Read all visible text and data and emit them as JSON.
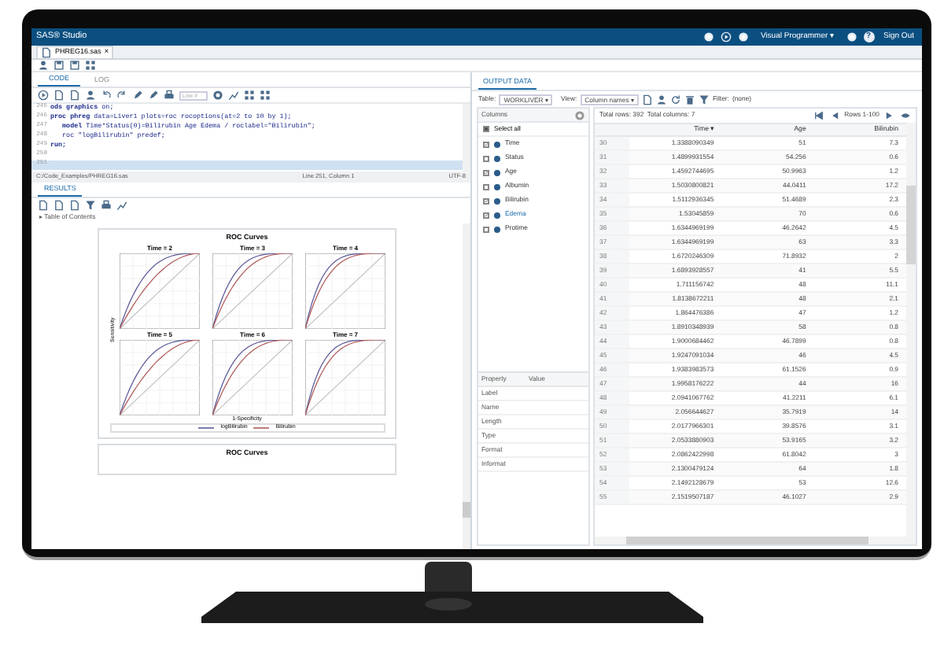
{
  "app_bar": {
    "title": "SAS® Studio",
    "mode": "Visual Programmer ▾",
    "help": "?",
    "sign_out": "Sign Out"
  },
  "file_tabs": [
    {
      "label": "PHREG16.sas",
      "close": "×",
      "selected": true
    }
  ],
  "code_panel": {
    "tabs": [
      {
        "label": "CODE",
        "selected": true
      },
      {
        "label": "LOG",
        "selected": false
      }
    ],
    "line_field": {
      "placeholder": "Line #"
    },
    "lines": [
      {
        "number": "245",
        "code": "**ods graphics** on;",
        "current": false
      },
      {
        "number": "246",
        "code": "**proc phreg** data=Liver1 plots=roc rocoptions(at=2 to 10 by 1);",
        "current": false
      },
      {
        "number": "247",
        "code": "   **model** Time*Status(0)=Bilirubin Age Edema / roclabel=\"Bilirubin\";",
        "current": false
      },
      {
        "number": "248",
        "code": "   roc \"logBilirubin\" predef;",
        "current": false
      },
      {
        "number": "249",
        "code": "**run;**",
        "current": false
      },
      {
        "number": "250",
        "current": false
      },
      {
        "number": "251",
        "current": true
      }
    ],
    "status": {
      "path": "C:/Code_Examples/PHREG16.sas",
      "position": "Line 251, Column 1",
      "encoding": "UTF-8"
    }
  },
  "results_panel": {
    "tabs": [
      {
        "label": "RESULTS",
        "selected": true
      }
    ],
    "toc": "▸ Table of Contents",
    "figures": [
      {
        "title": "ROC Curves",
        "panels": [
          "Time = 2",
          "Time = 3",
          "Time = 4",
          "Time = 5",
          "Time = 6",
          "Time = 7"
        ],
        "ylabel": "Sensitivity",
        "xlabel": "1-Specificity",
        "legend": [
          "logBilirubin",
          "Bilirubin"
        ]
      },
      {
        "title": "ROC Curves"
      }
    ]
  },
  "output_data": {
    "tabs": [
      {
        "label": "OUTPUT DATA",
        "selected": true
      }
    ],
    "table_label": "Table:",
    "table": "WORKLIVER ▾",
    "view_label": "View:",
    "view": "Column names ▾",
    "filter_label": "Filter:",
    "filter": "(none)",
    "columns_panel": {
      "title": "Columns",
      "select_all": {
        "label": "Select all",
        "partial": true
      },
      "items": [
        {
          "label": "Time",
          "checked": true,
          "selected": false
        },
        {
          "label": "Status",
          "checked": false,
          "selected": false
        },
        {
          "label": "Age",
          "checked": true,
          "selected": false
        },
        {
          "label": "Albumin",
          "checked": false,
          "selected": false
        },
        {
          "label": "Bilirubin",
          "checked": true,
          "selected": false
        },
        {
          "label": "Edema",
          "checked": true,
          "selected": true
        },
        {
          "label": "Protime",
          "checked": false,
          "selected": false
        }
      ]
    },
    "properties": {
      "headers": [
        "Property",
        "Value"
      ],
      "rows": [
        "Label",
        "Name",
        "Length",
        "Type",
        "Format",
        "Informat"
      ]
    },
    "grid": {
      "totals": "Total rows: 392  Total columns: 7",
      "range": "Rows 1-100",
      "columns": [
        "",
        "Time ▾",
        "Age",
        "Bilirubin"
      ],
      "rows": [
        [
          "30",
          "1.3388090349",
          "51",
          "7.3"
        ],
        [
          "31",
          "1.4899931554",
          "54.256",
          "0.6"
        ],
        [
          "32",
          "1.4592744695",
          "50.9963",
          "1.2"
        ],
        [
          "33",
          "1.5030800821",
          "44.0411",
          "17.2"
        ],
        [
          "34",
          "1.5112936345",
          "51.4689",
          "2.3"
        ],
        [
          "35",
          "1.53045859",
          "70",
          "0.6"
        ],
        [
          "36",
          "1.6344969199",
          "46.2642",
          "4.5"
        ],
        [
          "37",
          "1.6344969199",
          "63",
          "3.3"
        ],
        [
          "38",
          "1.6720246309",
          "71.8932",
          "2"
        ],
        [
          "39",
          "1.6893928557",
          "41",
          "5.5"
        ],
        [
          "40",
          "1.711156742",
          "48",
          "11.1"
        ],
        [
          "41",
          "1.8138672211",
          "48",
          "2.1"
        ],
        [
          "42",
          "1.864476386",
          "47",
          "1.2"
        ],
        [
          "43",
          "1.8910348939",
          "58",
          "0.8"
        ],
        [
          "44",
          "1.9000684462",
          "46.7899",
          "0.8"
        ],
        [
          "45",
          "1.9247091034",
          "46",
          "4.5"
        ],
        [
          "46",
          "1.9383983573",
          "61.1526",
          "0.9"
        ],
        [
          "47",
          "1.9958176222",
          "44",
          "16"
        ],
        [
          "48",
          "2.0941067762",
          "41.2211",
          "6.1"
        ],
        [
          "49",
          "2.056644627",
          "35.7919",
          "14"
        ],
        [
          "50",
          "2.0177966301",
          "39.8576",
          "3.1"
        ],
        [
          "51",
          "2.0533880903",
          "53.9165",
          "3.2"
        ],
        [
          "52",
          "2.0862422998",
          "61.8042",
          "3"
        ],
        [
          "53",
          "2.1300479124",
          "64",
          "1.8"
        ],
        [
          "54",
          "2.1492128679",
          "53",
          "12.6"
        ],
        [
          "55",
          "2.1519507187",
          "46.1027",
          "2.9"
        ]
      ]
    }
  }
}
